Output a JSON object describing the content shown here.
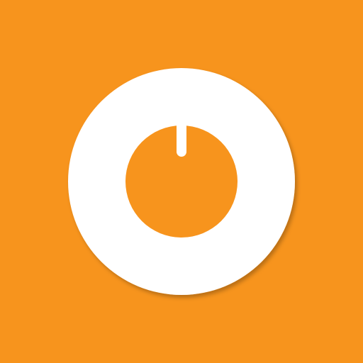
{
  "colors": {
    "background": "#f7941d",
    "ring": "#ffffff",
    "inner": "#f7941d",
    "indicator": "#ffffff",
    "shadow": "#c46f0e"
  },
  "icon": {
    "name": "power-knob-icon"
  }
}
